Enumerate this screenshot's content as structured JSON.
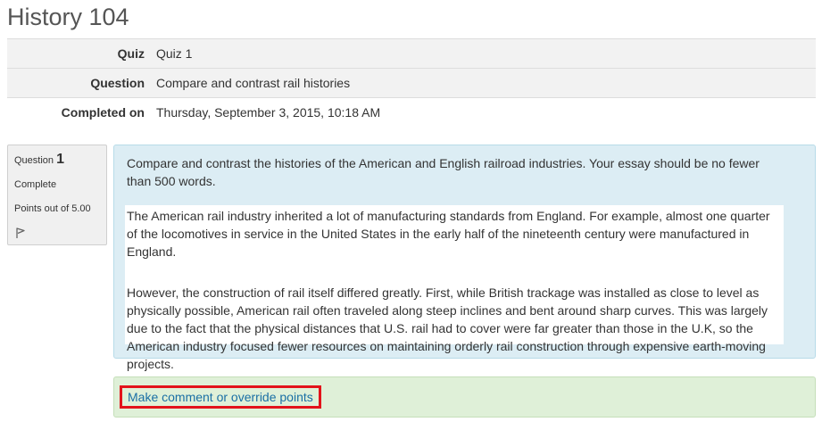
{
  "page": {
    "title": "History 104"
  },
  "summary": {
    "rows": [
      {
        "label": "Quiz",
        "value": "Quiz 1"
      },
      {
        "label": "Question",
        "value": "Compare and contrast rail histories"
      },
      {
        "label": "Completed on",
        "value": "Thursday, September 3, 2015, 10:18 AM"
      }
    ]
  },
  "question_info": {
    "question_label": "Question",
    "question_number": "1",
    "state": "Complete",
    "points": "Points out of 5.00",
    "flag_icon": "flag-icon"
  },
  "question": {
    "text": "Compare and contrast the histories of the American and English railroad industries.  Your essay should be no fewer than 500 words.",
    "answer_paragraphs": [
      "The American rail industry inherited a lot of manufacturing standards from England.  For example, almost one quarter of the locomotives in service in the United States in the early half of the nineteenth century were manufactured in England.",
      "However, the construction of rail itself differed greatly.  First, while British trackage was installed as close to level as physically possible, American rail often traveled along steep inclines and bent around sharp curves.  This was largely due to the fact that the physical distances that U.S. rail had to cover were far greater than those in the U.K, so the American industry focused fewer resources on maintaining orderly rail construction through expensive earth-moving projects."
    ]
  },
  "comment": {
    "link_label": "Make comment or override points",
    "highlight_color": "#e3131b"
  },
  "colors": {
    "content_background": "#dcedf4",
    "comment_background": "#dff0d8",
    "link": "#1a6fa5"
  }
}
